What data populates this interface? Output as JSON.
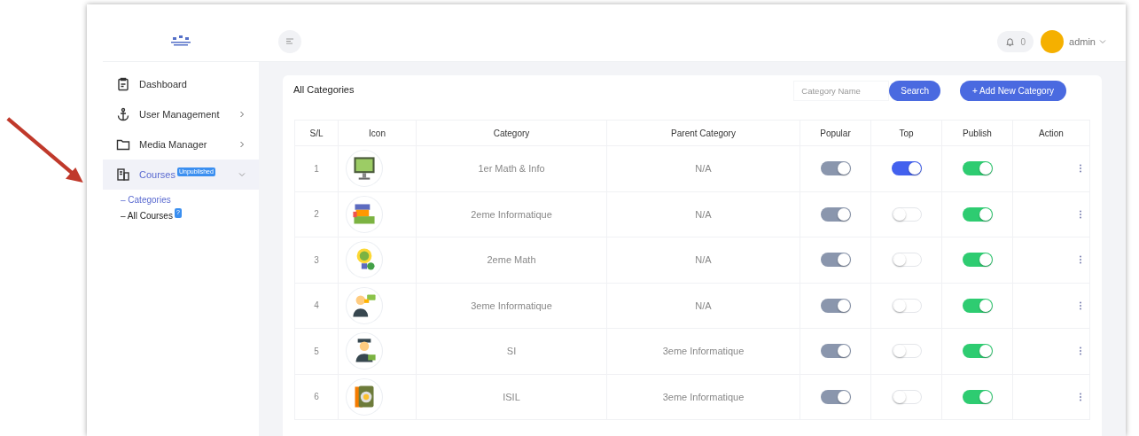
{
  "sidebar": {
    "items": [
      {
        "label": "Dashboard",
        "kind": "clipboard",
        "selected": false
      },
      {
        "label": "User Management",
        "kind": "anchor",
        "has_children": true,
        "expanded": false,
        "selected": false
      },
      {
        "label": "Media Manager",
        "kind": "folder",
        "has_children": true,
        "expanded": false,
        "selected": false
      },
      {
        "label": "Courses",
        "kind": "book",
        "badge": "Unpublished",
        "has_children": true,
        "expanded": true,
        "selected": true,
        "children": [
          {
            "label": "– Categories",
            "selected": true
          },
          {
            "label": "– All Courses",
            "badge": "?",
            "selected": false
          }
        ]
      }
    ]
  },
  "header": {
    "notifications": "0",
    "user": "admin"
  },
  "card": {
    "title": "All Categories",
    "search": {
      "placeholder": "Category Name"
    },
    "search_button": "Search",
    "add_button": "+ Add New Category"
  },
  "table": {
    "columns": [
      "S/L",
      "Icon",
      "Category",
      "Parent Category",
      "Popular",
      "Top",
      "Publish",
      "Action"
    ],
    "rows": [
      {
        "sl": "1",
        "category": "1er Math & Info",
        "parent": "N/A",
        "popular": true,
        "top": true,
        "publish": true
      },
      {
        "sl": "2",
        "category": "2eme Informatique",
        "parent": "N/A",
        "popular": true,
        "top": false,
        "publish": true
      },
      {
        "sl": "3",
        "category": "2eme Math",
        "parent": "N/A",
        "popular": true,
        "top": false,
        "publish": true
      },
      {
        "sl": "4",
        "category": "3eme Informatique",
        "parent": "N/A",
        "popular": true,
        "top": false,
        "publish": true
      },
      {
        "sl": "5",
        "category": "SI",
        "parent": "3eme Informatique",
        "popular": true,
        "top": false,
        "publish": true
      },
      {
        "sl": "6",
        "category": "ISIL",
        "parent": "3eme Informatique",
        "popular": true,
        "top": false,
        "publish": true
      }
    ]
  }
}
